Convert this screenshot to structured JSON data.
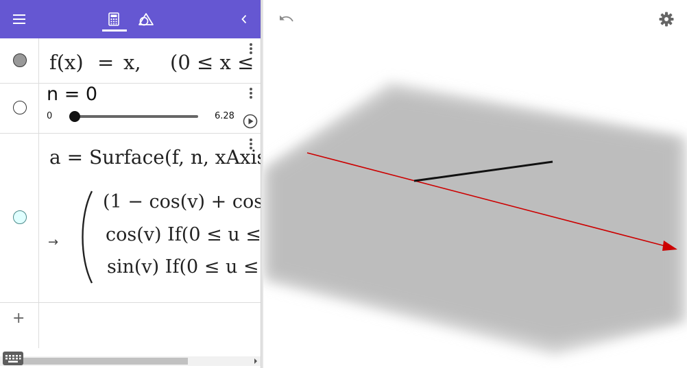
{
  "header": {
    "menu_icon": "hamburger-menu-icon",
    "calculator_icon": "calculator-icon",
    "geometry_icon": "triangle-circle-icon",
    "collapse_icon": "chevron-left-icon",
    "accent_color": "#6557d2"
  },
  "algebra": {
    "row1": {
      "lhs": "f(x)",
      "eq": "=",
      "rhs": "x,",
      "condition": "(0 ≤ x ≤",
      "marble_color": "#999999"
    },
    "row2": {
      "label": "n = 0",
      "slider_min": "0",
      "slider_max": "6.28",
      "slider_value": 0,
      "marble_color": "#ffffff"
    },
    "row3": {
      "definition": "a = Surface(f, n, xAxis",
      "arrow": "→",
      "line1": "(1 − cos(v) + cos",
      "line2": "cos(v) If(0 ≤ u ≤",
      "line3": "sin(v) If(0 ≤ u ≤",
      "marble_color": "#e0ffff"
    },
    "add_input": {
      "plus": "+"
    }
  },
  "toolbar": {
    "undo_icon": "undo-icon",
    "settings_icon": "gear-icon"
  },
  "colors": {
    "axis": "#cc0000",
    "surface": "#bdbdbd",
    "curve": "#111111"
  }
}
